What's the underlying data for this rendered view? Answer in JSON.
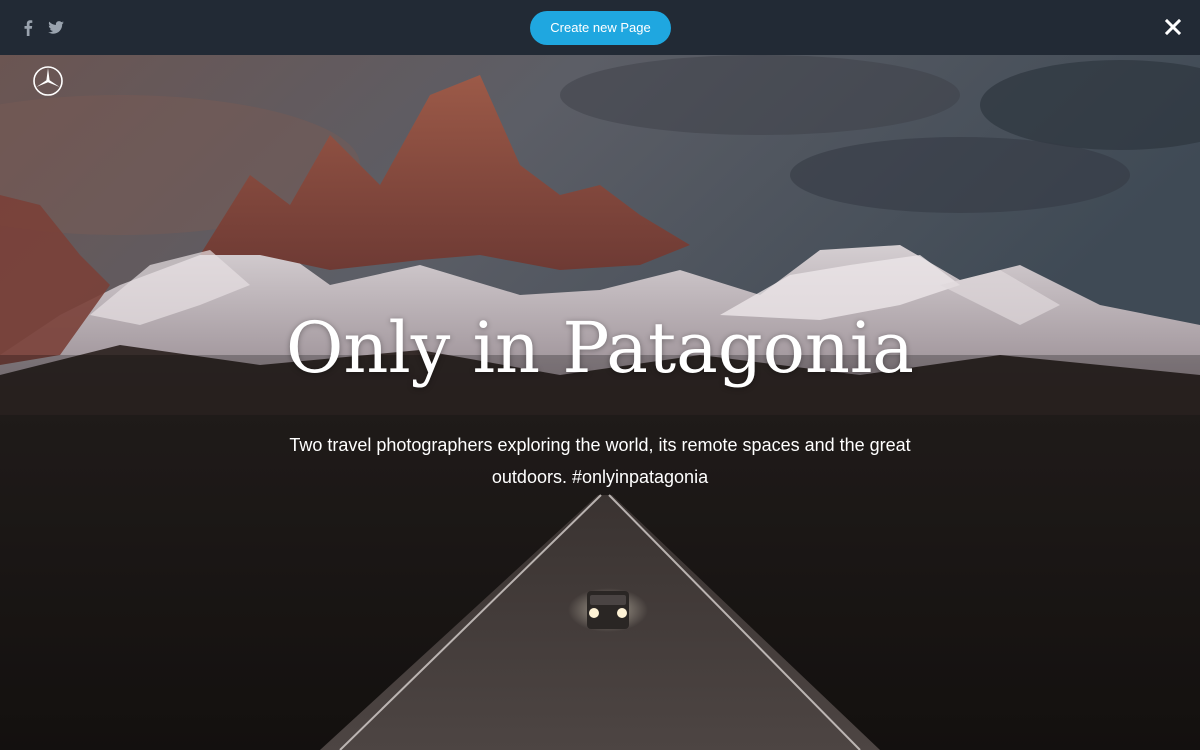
{
  "topbar": {
    "social_icons": [
      {
        "name": "facebook-icon",
        "glyph": "f"
      },
      {
        "name": "twitter-icon",
        "glyph": "twitter-bird"
      }
    ],
    "create_button_label": "Create new Page",
    "close_icon": "close-icon"
  },
  "hero": {
    "brand_logo": "mercedes-star-logo",
    "title": "Only in Patagonia",
    "subtitle": "Two travel photographers exploring the world, its remote spaces and the great outdoors. #onlyinpatagonia",
    "background": "mountains-road-photo"
  },
  "colors": {
    "topbar_bg": "#222a35",
    "button_bg": "#1fa7e0",
    "title_text": "#ffffff",
    "icon_gray": "#9aa3ae"
  }
}
